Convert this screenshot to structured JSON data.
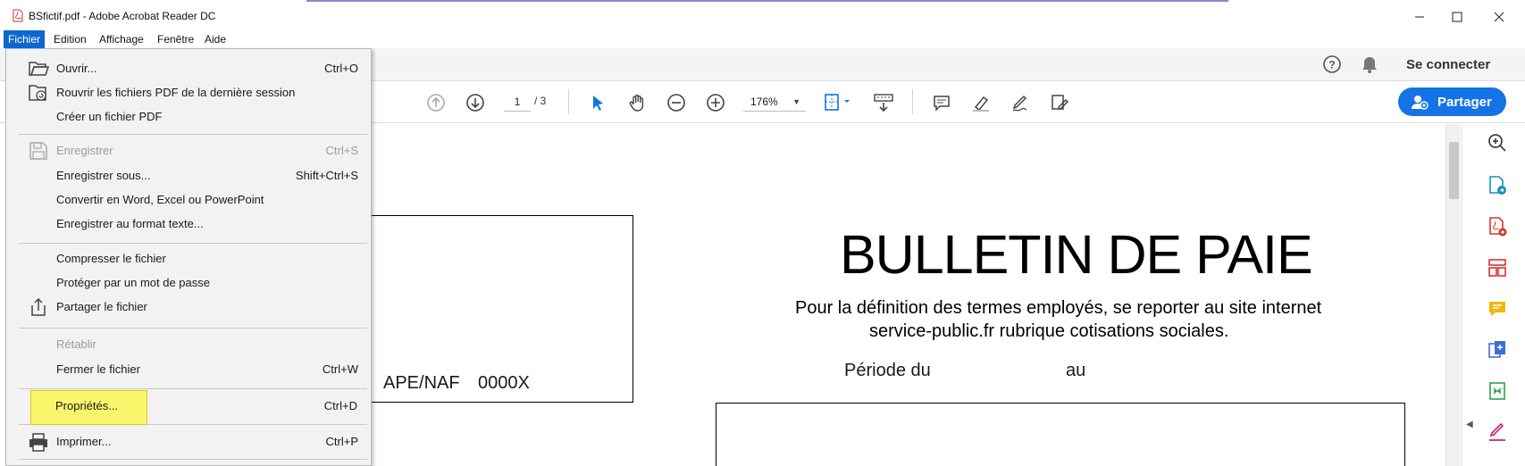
{
  "window": {
    "title": "BSfictif.pdf - Adobe Acrobat Reader DC"
  },
  "menubar": {
    "items": [
      "Fichier",
      "Edition",
      "Affichage",
      "Fenêtre",
      "Aide"
    ],
    "active": "Fichier"
  },
  "header": {
    "connect_label": "Se connecter"
  },
  "toolbar": {
    "page_current": "1",
    "page_total": "/ 3",
    "zoom": "176%",
    "share_label": "Partager"
  },
  "file_menu": {
    "items": [
      {
        "label": "Ouvrir...",
        "shortcut": "Ctrl+O",
        "icon": "folder-open-icon",
        "disabled": false
      },
      {
        "label": "Rouvrir les fichiers PDF de la dernière session",
        "shortcut": "",
        "icon": "reopen-icon",
        "disabled": false
      },
      {
        "label": "Créer un fichier PDF",
        "shortcut": "",
        "icon": "",
        "disabled": false
      },
      {
        "label": "Enregistrer",
        "shortcut": "Ctrl+S",
        "icon": "save-icon",
        "disabled": true
      },
      {
        "label": "Enregistrer sous...",
        "shortcut": "Shift+Ctrl+S",
        "icon": "",
        "disabled": false
      },
      {
        "label": "Convertir en Word, Excel ou PowerPoint",
        "shortcut": "",
        "icon": "",
        "disabled": false
      },
      {
        "label": "Enregistrer au format texte...",
        "shortcut": "",
        "icon": "",
        "disabled": false
      },
      {
        "label": "Compresser le fichier",
        "shortcut": "",
        "icon": "",
        "disabled": false
      },
      {
        "label": "Protéger par un mot de passe",
        "shortcut": "",
        "icon": "",
        "disabled": false
      },
      {
        "label": "Partager le fichier",
        "shortcut": "",
        "icon": "share-file-icon",
        "disabled": false
      },
      {
        "label": "Rétablir",
        "shortcut": "",
        "icon": "",
        "disabled": true
      },
      {
        "label": "Fermer le fichier",
        "shortcut": "Ctrl+W",
        "icon": "",
        "disabled": false
      },
      {
        "label": "Propriétés...",
        "shortcut": "Ctrl+D",
        "icon": "",
        "disabled": false,
        "highlighted": true
      },
      {
        "label": "Imprimer...",
        "shortcut": "Ctrl+P",
        "icon": "printer-icon",
        "disabled": false
      }
    ]
  },
  "document": {
    "title": "BULLETIN DE PAIE",
    "subtitle_line1": "Pour la définition des termes employés, se reporter au site internet",
    "subtitle_line2": "service-public.fr rubrique cotisations sociales.",
    "periode_label": "Période du",
    "au_label": "au",
    "ape_label": "APE/NAF",
    "ape_value": "0000X"
  },
  "colors": {
    "accent": "#1473e6",
    "menu_active": "#0d67d1",
    "highlight": "#f9f66c"
  }
}
